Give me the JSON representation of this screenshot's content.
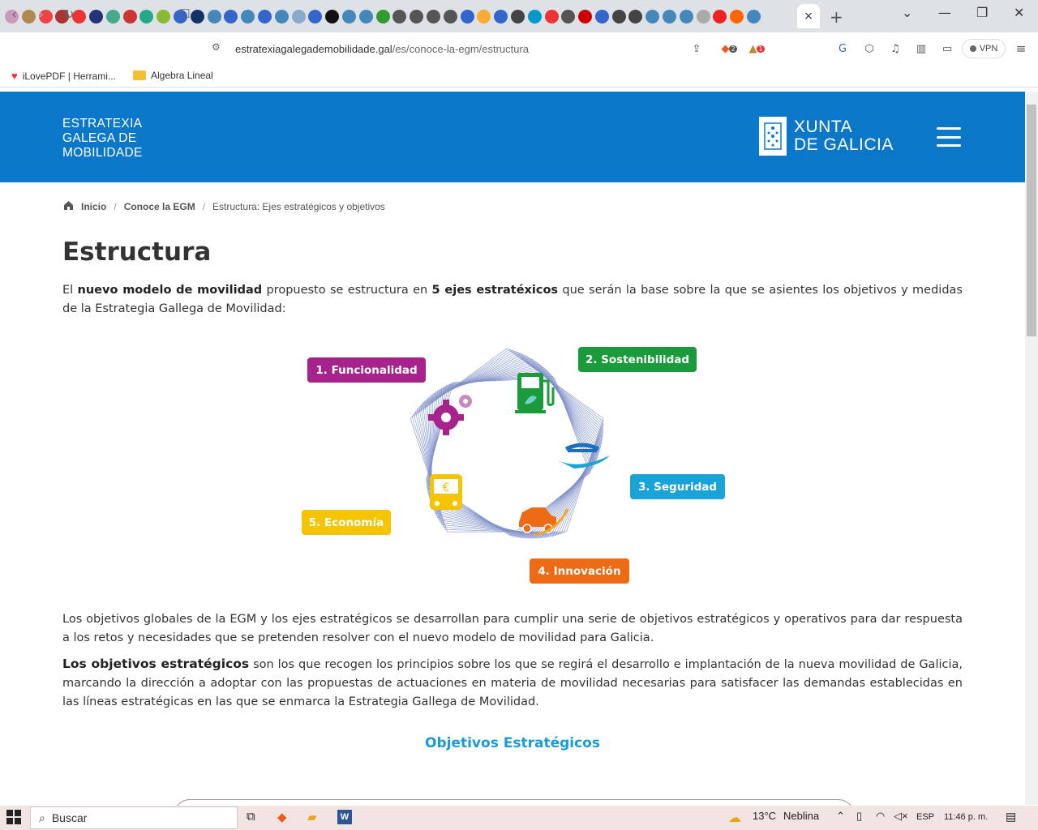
{
  "browser": {
    "tab_favicon_colors": [
      "#c9b",
      "#b08850",
      "#e44",
      "#a33",
      "#e33",
      "#237",
      "#4a8",
      "#c33",
      "#2a8",
      "#8b3",
      "#36c",
      "#136",
      "#48b",
      "#36c",
      "#48b",
      "#36c",
      "#48b",
      "#8ac",
      "#36c",
      "#111",
      "#48b",
      "#48b",
      "#393",
      "#555",
      "#555",
      "#555",
      "#555",
      "#36c",
      "#fa3",
      "#36c",
      "#444",
      "#09c",
      "#e33",
      "#555",
      "#c00",
      "#36c",
      "#444",
      "#444",
      "#48b",
      "#48b",
      "#48b",
      "#aaa",
      "#e22",
      "#f60",
      "#48b"
    ],
    "active_tab_close": "×",
    "new_tab": "+",
    "window_controls": {
      "minimize": "—",
      "restore": "❐",
      "close": "✕",
      "tab_list": "⌄"
    },
    "url_host": "estratexiagalegademobilidade.gal",
    "url_path": "/es/conoce-la-egm/estructura",
    "vpn_label": "VPN",
    "brave_badge": "2",
    "rewards_badge": "1",
    "bookmarks": [
      {
        "label": "iLovePDF | Herrami...",
        "icon": "heart-icon"
      },
      {
        "label": "Algebra Lineal",
        "icon": "folder-icon"
      }
    ]
  },
  "header": {
    "logo_lines": [
      "ESTRATEXIA",
      "GALEGA DE",
      "MOBILIDADE"
    ],
    "xunta_lines": [
      "XUNTA",
      "DE GALICIA"
    ]
  },
  "breadcrumb": {
    "home": "Inicio",
    "section": "Conoce la EGM",
    "current": "Estructura: Ejes estratégicos y objetivos",
    "sep": "/"
  },
  "main": {
    "title": "Estructura",
    "intro": {
      "t1": "El ",
      "b1": "nuevo modelo de movilidad",
      "t2": " propuesto se estructura en ",
      "b2": "5 ejes estratéxicos",
      "t3": " que serán la base sobre la que se asientes los objetivos y medidas de la Estrategia Gallega de Movilidad:"
    },
    "axes": [
      {
        "label": "1. Funcionalidad",
        "color": "#a6238c"
      },
      {
        "label": "2. Sostenibilidad",
        "color": "#1a9a3a"
      },
      {
        "label": "3. Seguridad",
        "color": "#1aa3d6"
      },
      {
        "label": "4. Innovación",
        "color": "#ec6b14"
      },
      {
        "label": "5. Economía",
        "color": "#f5c400"
      }
    ],
    "para2": "Los objetivos globales de la EGM y los ejes estratégicos se desarrollan para cumplir una serie de objetivos estratégicos y operativos para dar respuesta a los retos y necesidades que se pretenden resolver con el nuevo modelo de movilidad para Galicia.",
    "para3": {
      "b": "Los objetivos estratégicos",
      "t": " son los que recogen los principios sobre los que se regirá el desarrollo e implantación de la nueva movilidad de Galicia, marcando la dirección a adoptar con las propuestas de actuaciones en materia de movilidad necesarias para satisfacer las demandas establecidas en las líneas estratégicas en las que se enmarca la Estrategia Gallega de Movilidad."
    },
    "subtitle": "Objetivos Estratégicos"
  },
  "taskbar": {
    "search_placeholder": "Buscar",
    "weather": "13°C",
    "weather_desc": "Neblina",
    "lang": "ESP",
    "time": "11:46 p. m.",
    "chevron": "⌃"
  }
}
